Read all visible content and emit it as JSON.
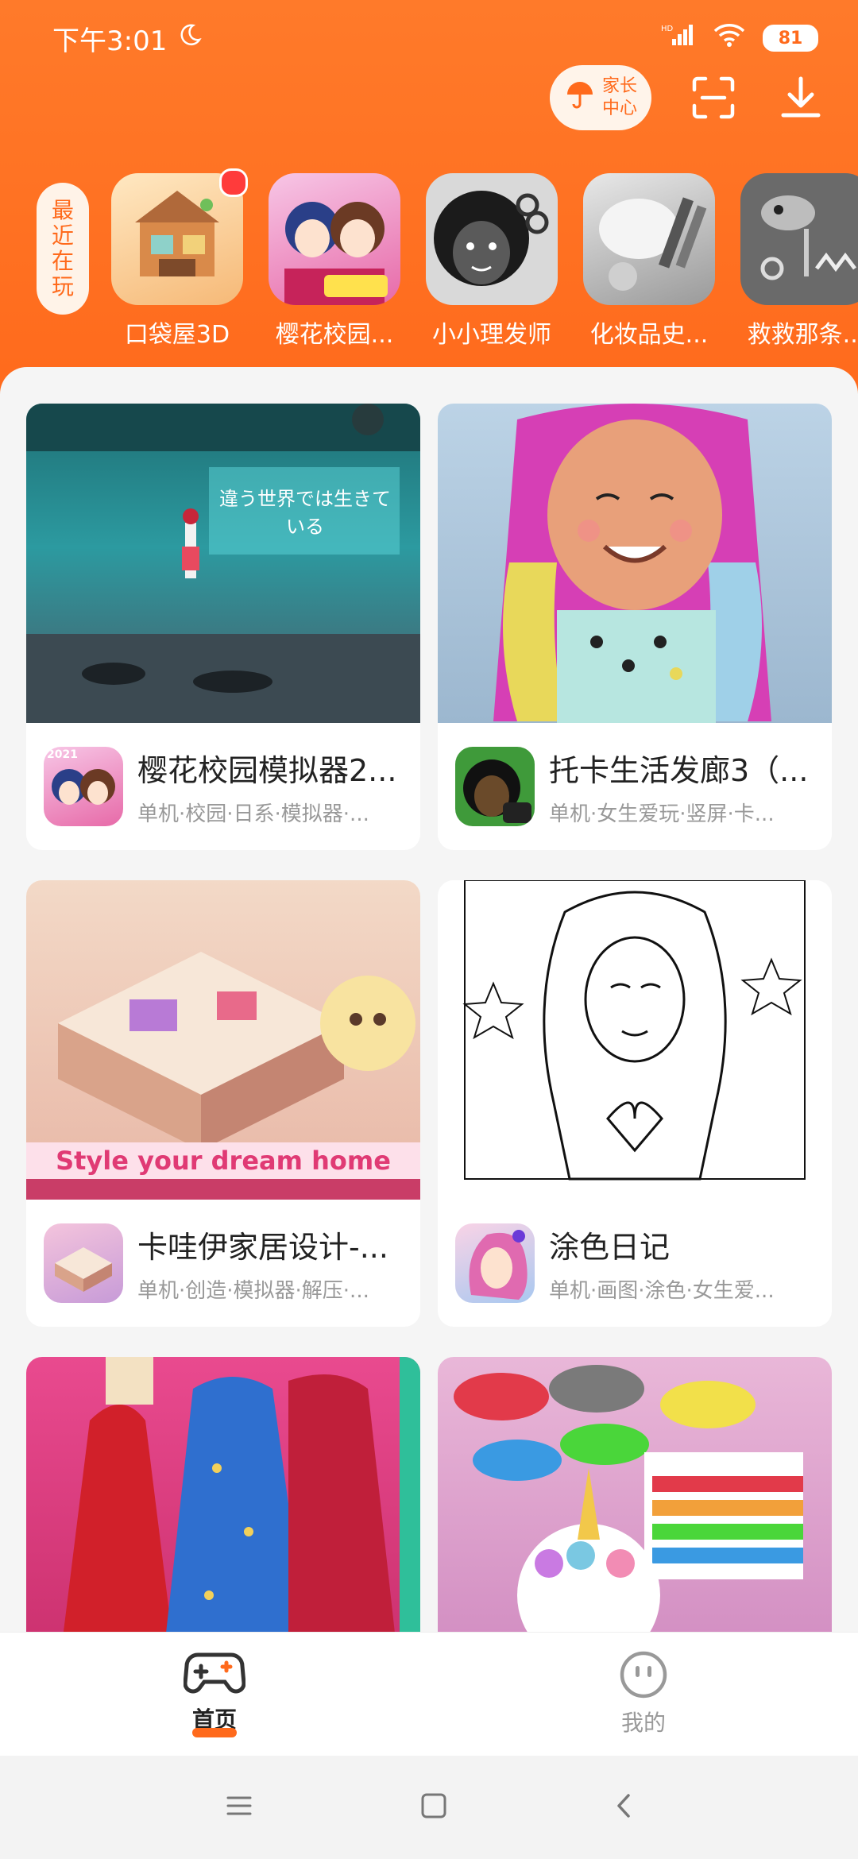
{
  "status_bar": {
    "time": "下午3:01",
    "network": "HD",
    "battery": "81"
  },
  "header": {
    "parent_center_line1": "家长",
    "parent_center_line2": "中心"
  },
  "recent": {
    "tag": [
      "最",
      "近",
      "在",
      "玩"
    ],
    "items": [
      {
        "label": "口袋屋3D",
        "has_dot": true
      },
      {
        "label": "樱花校园..."
      },
      {
        "label": "小小理发师"
      },
      {
        "label": "化妆品史..."
      },
      {
        "label": "救救那条..."
      }
    ]
  },
  "cards": [
    {
      "title": "樱花校园模拟器2...",
      "tags": "单机·校园·日系·模拟器·...",
      "image_text": "違う世界では生きている",
      "badge": "2021"
    },
    {
      "title": "托卡生活发廊3（...",
      "tags": "单机·女生爱玩·竖屏·卡..."
    },
    {
      "title": "卡哇伊家居设计-...",
      "tags": "单机·创造·模拟器·解压·...",
      "image_text": "Style your dream home"
    },
    {
      "title": "涂色日记",
      "tags": "单机·画图·涂色·女生爱..."
    },
    {
      "title": ""
    },
    {
      "title": ""
    }
  ],
  "nav": {
    "home": "首页",
    "mine": "我的"
  },
  "colors": {
    "accent": "#ff6a1c"
  }
}
